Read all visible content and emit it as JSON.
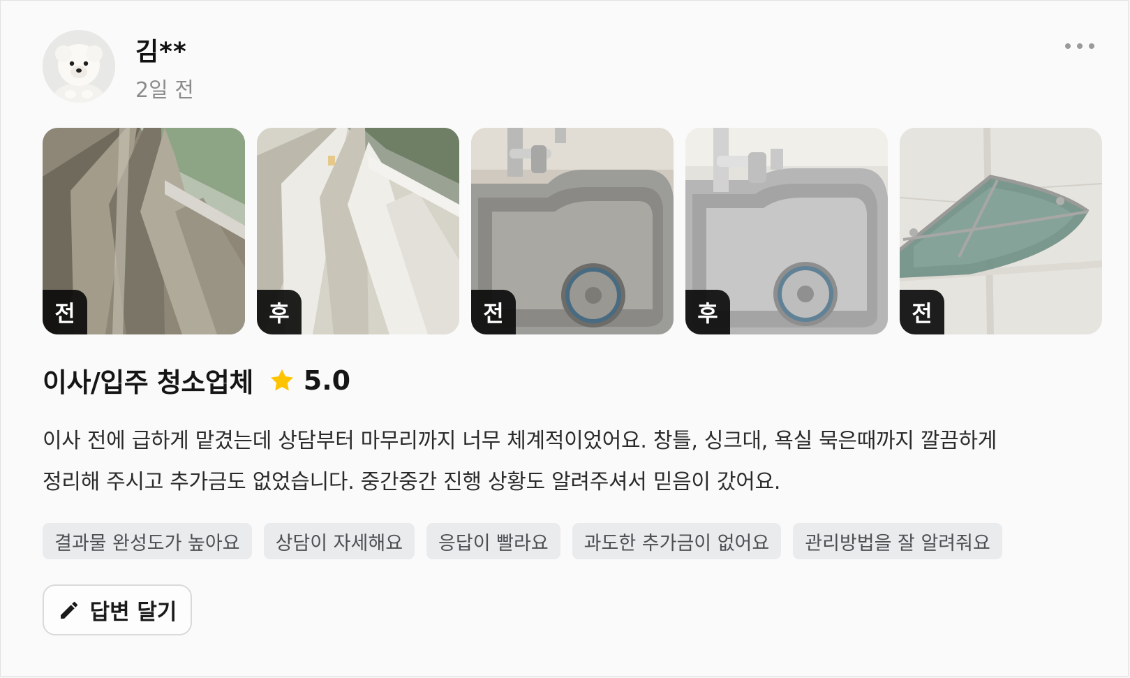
{
  "review": {
    "reviewer_name": "김**",
    "date": "2일 전",
    "avatar": "white-puppy-avatar",
    "more_icon": "more-dots-icon"
  },
  "photos": [
    {
      "badge": "전",
      "subject": "window-track-before"
    },
    {
      "badge": "후",
      "subject": "window-track-after"
    },
    {
      "badge": "전",
      "subject": "sink-before"
    },
    {
      "badge": "후",
      "subject": "sink-after"
    },
    {
      "badge": "전",
      "subject": "bathroom-shelf-before"
    }
  ],
  "service": {
    "title": "이사/입주 청소업체",
    "rating": "5.0",
    "star_color": "#FFC400"
  },
  "body": {
    "line1": "이사 전에 급하게 맡겼는데 상담부터 마무리까지 너무 체계적이었어요. 창틀, 싱크대, 욕실 묵은때까지 깔끔하게",
    "line2": "정리해 주시고 추가금도 없었습니다. 중간중간 진행 상황도 알려주셔서 믿음이 갔어요."
  },
  "tags": [
    "결과물 완성도가 높아요",
    "상담이 자세해요",
    "응답이 빨라요",
    "과도한 추가금이 없어요",
    "관리방법을 잘 알려줘요"
  ],
  "reply": {
    "label": "답변 달기",
    "icon": "pencil-icon"
  }
}
